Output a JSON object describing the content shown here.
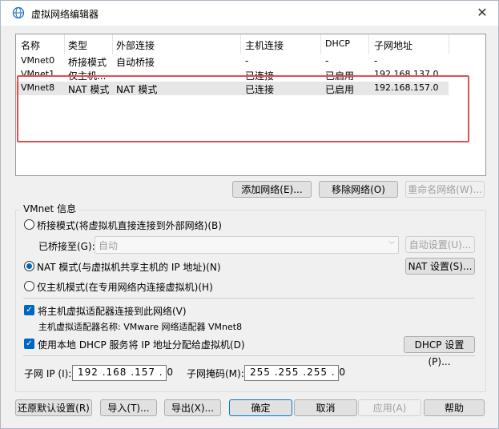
{
  "window": {
    "title": "虚拟网络编辑器",
    "close_icon": "close-icon"
  },
  "list": {
    "columns": [
      "名称",
      "类型",
      "外部连接",
      "主机连接",
      "DHCP",
      "子网地址"
    ],
    "rows": [
      {
        "name": "VMnet0",
        "type": "桥接模式",
        "external": "自动桥接",
        "host": "-",
        "dhcp": "-",
        "subnet": "-"
      },
      {
        "name": "VMnet1",
        "type": "仅主机...",
        "external": "",
        "host": "已连接",
        "dhcp": "已启用",
        "subnet": "192.168.137.0"
      },
      {
        "name": "VMnet8",
        "type": "NAT 模式",
        "external": "NAT 模式",
        "host": "已连接",
        "dhcp": "已启用",
        "subnet": "192.168.157.0"
      }
    ],
    "highlight_color": "#e05050"
  },
  "list_buttons": {
    "add": "添加网络(E)...",
    "remove": "移除网络(O)",
    "rename": "重命名网络(W)..."
  },
  "vmnet_info": {
    "label": "VMnet 信息",
    "bridged": "桥接模式(将虚拟机直接连接到外部网络)(B)",
    "bridged_to_label": "已桥接至(G):",
    "bridged_to_value": "自动",
    "auto_settings": "自动设置(U)...",
    "nat": "NAT 模式(与虚拟机共享主机的 IP 地址)(N)",
    "nat_settings": "NAT 设置(S)...",
    "host_only": "仅主机模式(在专用网络内连接虚拟机)(H)",
    "connect_adapter": "将主机虚拟适配器连接到此网络(V)",
    "adapter_name": "主机虚拟适配器名称: VMware 网络适配器 VMnet8",
    "use_dhcp": "使用本地 DHCP 服务将 IP 地址分配给虚拟机(D)",
    "dhcp_settings": "DHCP 设置(P)...",
    "subnet_ip_label": "子网 IP (I):",
    "subnet_ip": "192 .168 .157 . 0",
    "subnet_mask_label": "子网掩码(M):",
    "subnet_mask": "255 .255 .255 . 0",
    "selected_mode": "nat",
    "connect_adapter_checked": true,
    "use_dhcp_checked": true
  },
  "footer": {
    "restore": "还原默认设置(R)",
    "import": "导入(T)...",
    "export": "导出(X)...",
    "ok": "确定",
    "cancel": "取消",
    "apply": "应用(A)",
    "help": "帮助"
  },
  "colors": {
    "accent": "#0067c0"
  }
}
